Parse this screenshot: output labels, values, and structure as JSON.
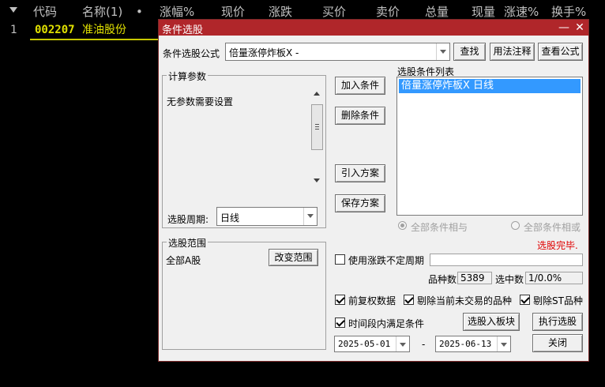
{
  "list_header": {
    "columns": [
      "代码",
      "名称(1)",
      "•",
      "涨幅%",
      "现价",
      "涨跌",
      "买价",
      "卖价",
      "总量",
      "现量",
      "涨速%",
      "换手%"
    ]
  },
  "list_row": {
    "index": "1",
    "code": "002207",
    "name": "准油股份"
  },
  "dialog": {
    "title": "条件选股",
    "minimize": "—",
    "close": "✕",
    "formula_label": "条件选股公式",
    "formula_value": "倍量涨停炸板X -",
    "find_button": "查找",
    "usage_button": "用法注释",
    "view_formula_button": "查看公式",
    "params_group": "计算参数",
    "params_text": "无参数需要设置",
    "period_label": "选股周期:",
    "period_value": "日线",
    "add_button": "加入条件",
    "delete_button": "删除条件",
    "import_button": "引入方案",
    "save_button": "保存方案",
    "cond_list_label": "选股条件列表",
    "cond_items": [
      "倍量涨停炸板X  日线"
    ],
    "radio_and": "全部条件相与",
    "radio_or": "全部条件相或",
    "status": "选股完毕.",
    "range_group": "选股范围",
    "range_value": "全部A股",
    "change_range_button": "改变范围",
    "use_unfixed_period": "使用涨跌不定周期",
    "count_label": "品种数",
    "count_value": "5389",
    "selected_label": "选中数",
    "selected_value": "1/0.0%",
    "opt_restore": "前复权数据",
    "opt_remove_untraded": "剔除当前未交易的品种",
    "opt_remove_st": "剔除ST品种",
    "opt_time_range": "时间段内满足条件",
    "to_sector_button": "选股入板块",
    "execute_button": "执行选股",
    "date_from": "2025-05-01",
    "date_sep": "-",
    "date_to": "2025-06-13",
    "close_button": "关闭"
  },
  "colors": {
    "title_bar": "#b0262a",
    "selection": "#3399ff",
    "status_red": "#e00000",
    "row_code": "#e0e000"
  }
}
